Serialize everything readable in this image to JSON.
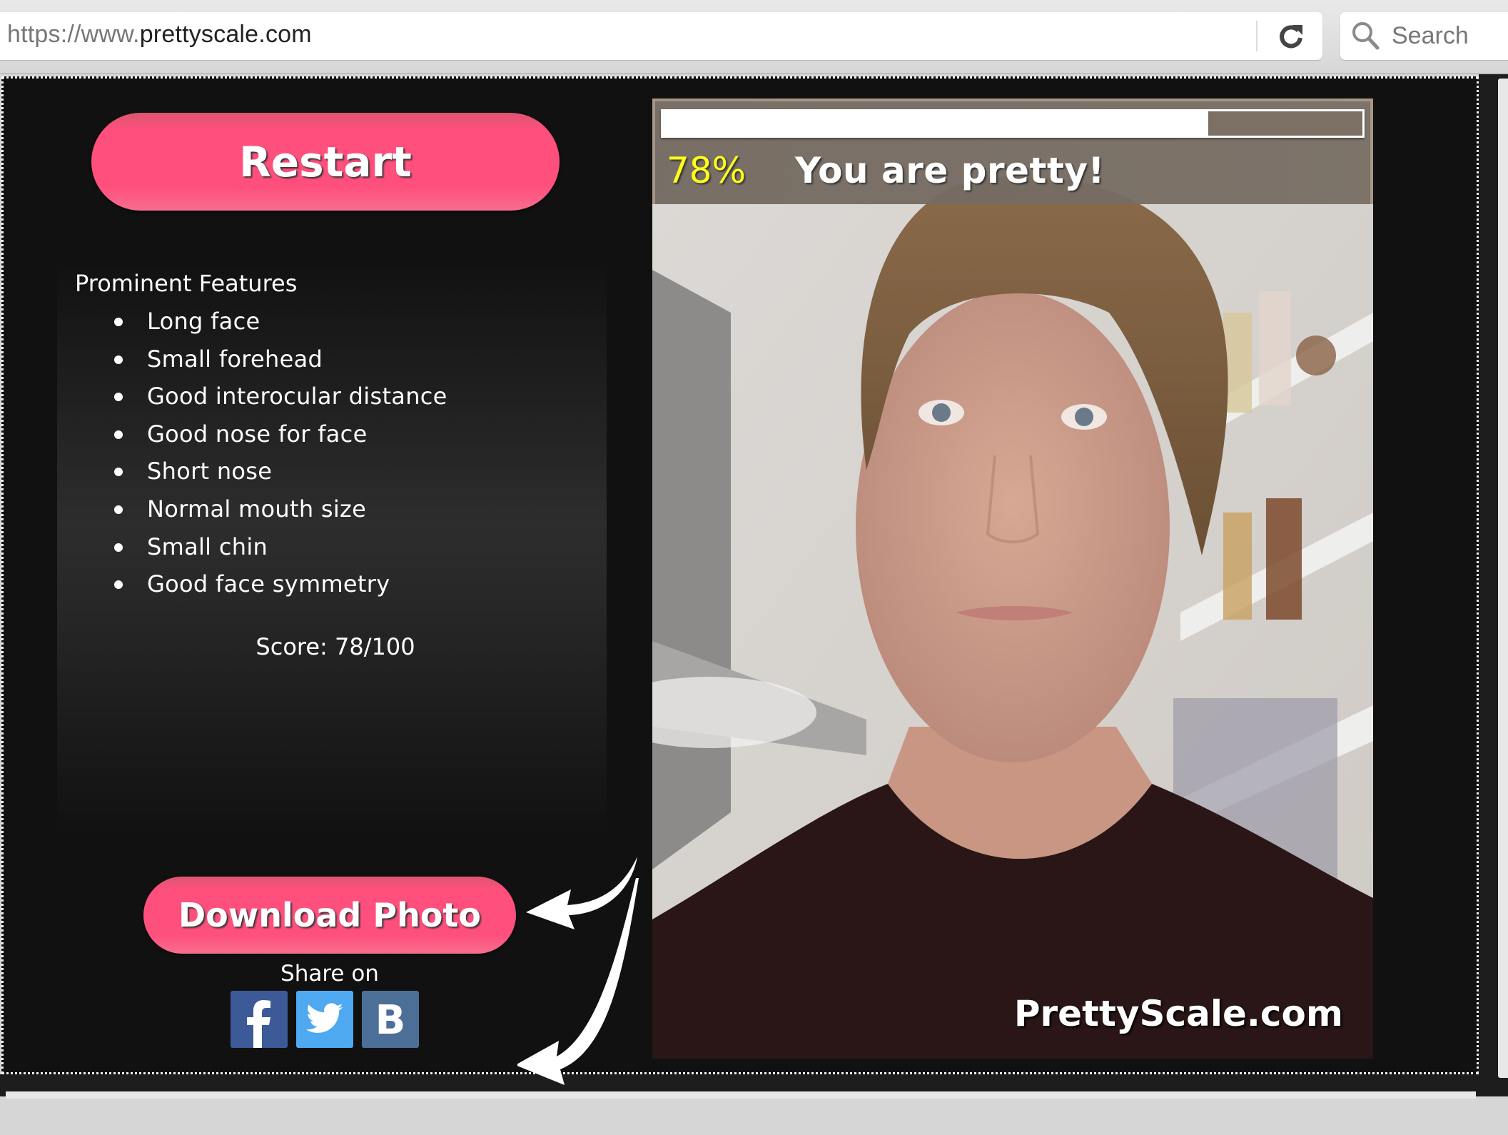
{
  "browser": {
    "url_scheme": "https://www.",
    "url_host": "prettyscale.com",
    "search_placeholder": "Search",
    "icons": {
      "reload": "reload-icon",
      "search": "search-icon"
    }
  },
  "app": {
    "restart_label": "Restart",
    "features_title": "Prominent Features",
    "features": [
      "Long face",
      "Small forehead",
      "Good interocular distance",
      "Good nose for face",
      "Short nose",
      "Normal mouth size",
      "Small chin",
      "Good face symmetry"
    ],
    "score_text": "Score: 78/100",
    "download_label": "Download Photo",
    "share_label": "Share on",
    "share_buttons": [
      {
        "name": "facebook",
        "glyph": "f",
        "color": "#3d5a98"
      },
      {
        "name": "twitter",
        "glyph": "bird",
        "color": "#4ea9f0"
      },
      {
        "name": "vk",
        "glyph": "B",
        "color": "#4c6f97"
      }
    ]
  },
  "result": {
    "percent_label": "78%",
    "progress_fraction": 0.78,
    "verdict": "You are pretty!",
    "watermark": "PrettyScale.com",
    "percent_color": "#ffff1a"
  },
  "colors": {
    "accent_pink": "#ff4f7d",
    "page_bg": "#111111"
  }
}
